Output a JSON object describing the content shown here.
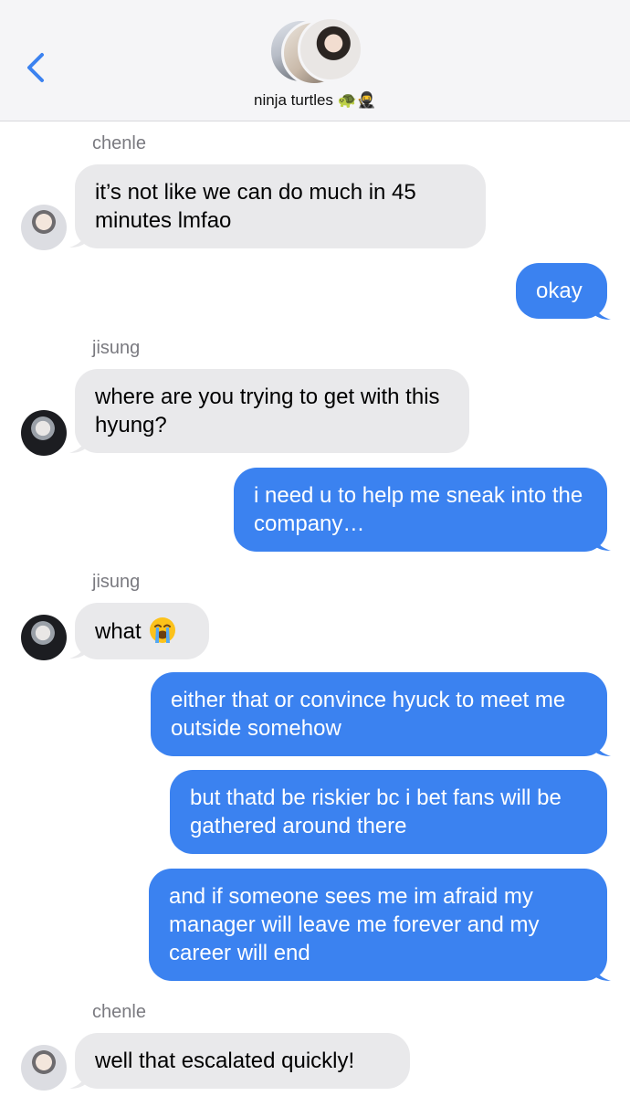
{
  "header": {
    "back_icon": "chevron-left-icon",
    "group_name": "ninja turtles 🐢🥷",
    "accent": "#3b82f0"
  },
  "colors": {
    "sent": "#3b82f0",
    "received": "#e9e9eb"
  },
  "messages": [
    {
      "sender": "chenle",
      "text": "it’s not like we can do much in 45 minutes lmfao"
    },
    {
      "text": "okay"
    },
    {
      "sender": "jisung",
      "text": "where are you trying to get with this hyung?"
    },
    {
      "text": "i need u to help me sneak into the company…"
    },
    {
      "sender": "jisung",
      "text": "what",
      "emoji": "loudly-crying-face"
    },
    {
      "text": "either that or convince hyuck to meet me outside somehow"
    },
    {
      "text": "but thatd be riskier bc i bet fans will be gathered around there"
    },
    {
      "text": "and if someone sees me im afraid my manager will leave me forever and my career will end"
    },
    {
      "sender": "chenle",
      "text": "well that escalated quickly!"
    }
  ]
}
